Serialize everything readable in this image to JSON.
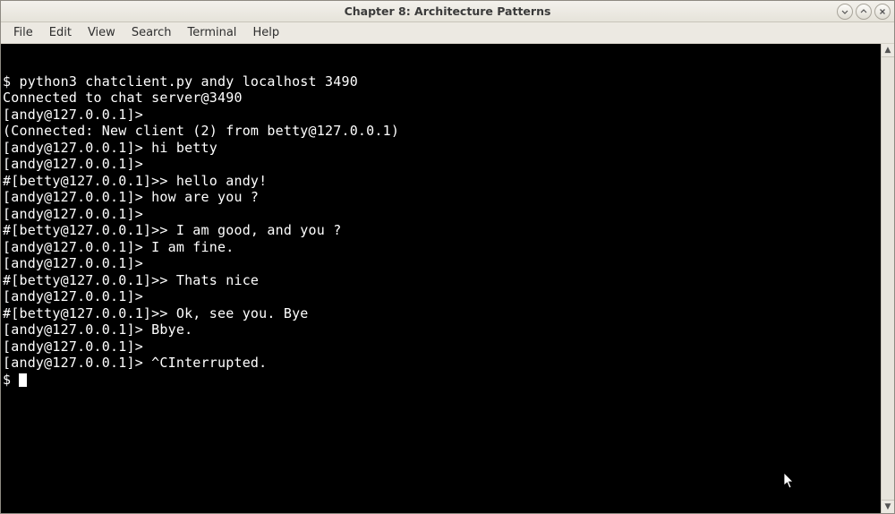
{
  "window": {
    "title": "Chapter 8: Architecture Patterns"
  },
  "menu": {
    "file": "File",
    "edit": "Edit",
    "view": "View",
    "search": "Search",
    "terminal": "Terminal",
    "help": "Help"
  },
  "terminal": {
    "lines": [
      "",
      "$ python3 chatclient.py andy localhost 3490",
      "Connected to chat server@3490",
      "[andy@127.0.0.1]>",
      "(Connected: New client (2) from betty@127.0.0.1)",
      "[andy@127.0.0.1]> hi betty",
      "[andy@127.0.0.1]>",
      "#[betty@127.0.0.1]>> hello andy!",
      "[andy@127.0.0.1]> how are you ?",
      "[andy@127.0.0.1]>",
      "#[betty@127.0.0.1]>> I am good, and you ?",
      "[andy@127.0.0.1]> I am fine.",
      "[andy@127.0.0.1]>",
      "#[betty@127.0.0.1]>> Thats nice",
      "[andy@127.0.0.1]>",
      "#[betty@127.0.0.1]>> Ok, see you. Bye",
      "[andy@127.0.0.1]> Bbye.",
      "[andy@127.0.0.1]>",
      "[andy@127.0.0.1]> ^CInterrupted."
    ],
    "final_prompt": "$ "
  }
}
